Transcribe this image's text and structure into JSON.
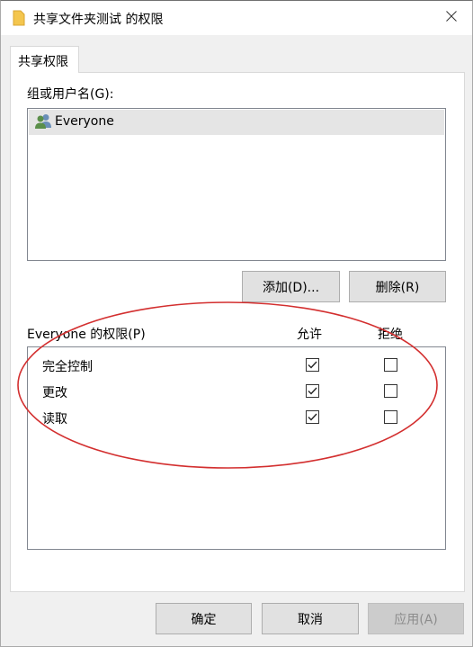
{
  "window": {
    "title": "共享文件夹测试 的权限",
    "folder_icon": "folder-icon",
    "close_icon": "close-icon"
  },
  "tabs": [
    {
      "label": "共享权限",
      "selected": true
    }
  ],
  "group_section": {
    "label": "组或用户名(G):",
    "users": [
      {
        "name": "Everyone",
        "icon": "users-icon",
        "selected": true
      }
    ]
  },
  "group_buttons": {
    "add_label": "添加(D)...",
    "remove_label": "删除(R)"
  },
  "permissions": {
    "header_label": "Everyone 的权限(P)",
    "allow_header": "允许",
    "deny_header": "拒绝",
    "rows": [
      {
        "name": "完全控制",
        "allow": true,
        "deny": false
      },
      {
        "name": "更改",
        "allow": true,
        "deny": false
      },
      {
        "name": "读取",
        "allow": true,
        "deny": false
      }
    ]
  },
  "footer": {
    "ok_label": "确定",
    "cancel_label": "取消",
    "apply_label": "应用(A)",
    "apply_enabled": false
  },
  "colors": {
    "annotation_ellipse": "#d32f2f",
    "dialog_bg": "#f0f0f0",
    "list_selection": "#e5e5e5",
    "folder": "#f4c64e"
  }
}
